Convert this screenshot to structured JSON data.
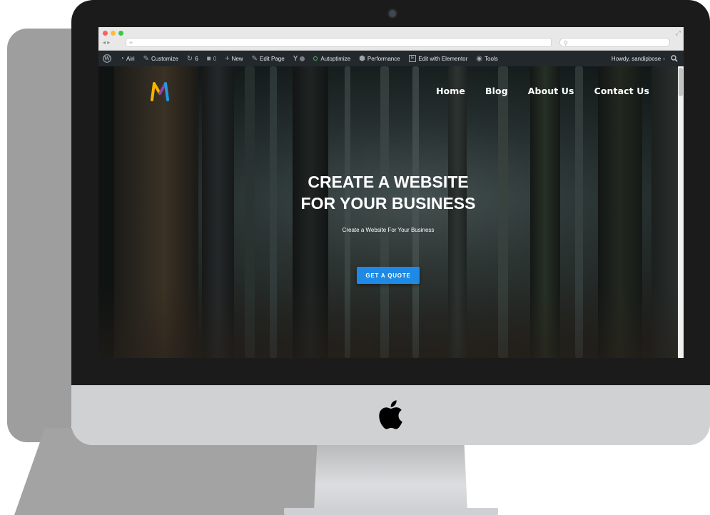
{
  "browser": {
    "url_placeholder": "+",
    "search_placeholder": "⚲"
  },
  "admin_bar": {
    "site_name": "Airi",
    "customize": "Customize",
    "updates_count": "6",
    "comments_count": "0",
    "new": "New",
    "edit_page": "Edit Page",
    "autoptimize": "Autoptimize",
    "performance": "Performance",
    "edit_with_elementor": "Edit with Elementor",
    "tools": "Tools",
    "howdy": "Howdy, sandipbose"
  },
  "site": {
    "nav": {
      "home": "Home",
      "blog": "Blog",
      "about": "About Us",
      "contact": "Contact Us"
    },
    "hero": {
      "title_line1": "CREATE A WEBSITE",
      "title_line2": "FOR YOUR BUSINESS",
      "subtitle": "Create a Website For Your Business",
      "cta": "GET A QUOTE"
    }
  },
  "colors": {
    "cta_blue": "#1e8ae6",
    "admin_bar": "#23282d",
    "bezel": "#1b1b1b",
    "chin": "#d0d1d3"
  }
}
